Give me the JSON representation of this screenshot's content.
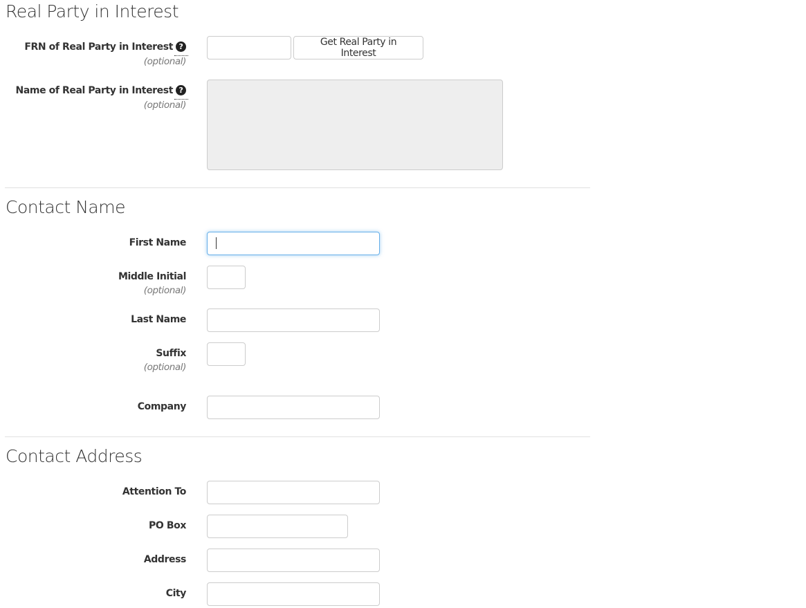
{
  "sections": {
    "real_party": {
      "title": "Real Party in Interest",
      "frn_label": "FRN of Real Party in Interest",
      "frn_optional": "(optional)",
      "frn_value": "",
      "get_button": "Get Real Party in Interest",
      "name_label": "Name of Real Party in Interest",
      "name_optional": "(optional)",
      "name_value": "",
      "help_icon": "?"
    },
    "contact_name": {
      "title": "Contact Name",
      "first_name_label": "First Name",
      "first_name_value": "",
      "middle_initial_label": "Middle Initial",
      "middle_initial_optional": "(optional)",
      "last_name_label": "Last Name",
      "suffix_label": "Suffix",
      "suffix_optional": "(optional)",
      "company_label": "Company"
    },
    "contact_address": {
      "title": "Contact Address",
      "attention_to_label": "Attention To",
      "po_box_label": "PO Box",
      "address_label": "Address",
      "city_label": "City"
    }
  }
}
